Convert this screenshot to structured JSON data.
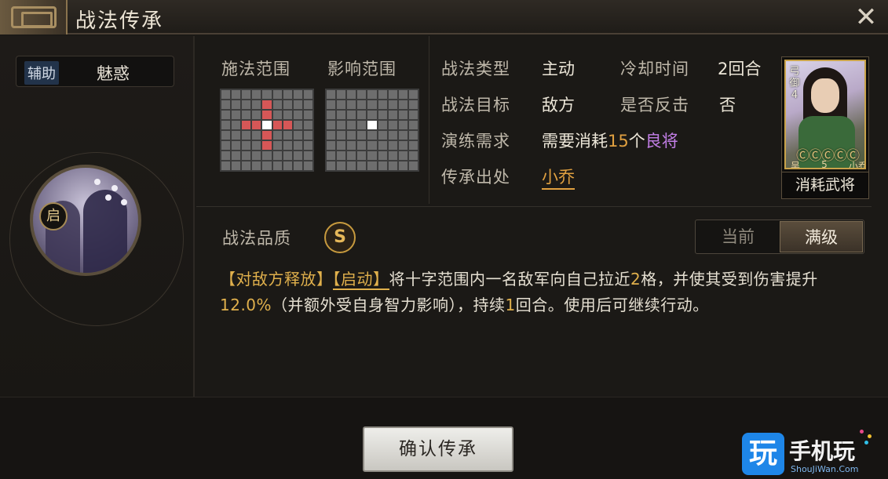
{
  "window": {
    "title": "战法传承"
  },
  "skill": {
    "category_badge": "辅助",
    "name": "魅惑",
    "badge": "启"
  },
  "range": {
    "cast_label": "施法范围",
    "effect_label": "影响范围",
    "cast_grid": {
      "rows": 8,
      "cols": 9,
      "cells": [
        "---------",
        "----r----",
        "----r----",
        "--rrwrr--",
        "----r----",
        "----r----",
        "---------",
        "---------"
      ]
    },
    "effect_grid": {
      "rows": 8,
      "cols": 9,
      "cells": [
        "---------",
        "---------",
        "---------",
        "----w----",
        "---------",
        "---------",
        "---------",
        "---------"
      ]
    }
  },
  "info": {
    "type_label": "战法类型",
    "type_value": "主动",
    "cooldown_label": "冷却时间",
    "cooldown_value": "2回合",
    "target_label": "战法目标",
    "target_value": "敌方",
    "counter_label": "是否反击",
    "counter_value": "否",
    "practice_label": "演练需求",
    "practice_prefix": "需要消耗",
    "practice_count": "15",
    "practice_unit": "个",
    "practice_rank": "良将",
    "source_label": "传承出处",
    "source_value": "小乔"
  },
  "hero_card": {
    "side_text": "弓御4",
    "stars": "ⒸⒸⒸⒸⒸ",
    "faction": "吴",
    "cost": "5",
    "name": "小乔",
    "footer": "消耗武将"
  },
  "quality": {
    "label": "战法品质",
    "grade": "S"
  },
  "level_toggle": {
    "current": "当前",
    "max": "满级",
    "selected": "max"
  },
  "description": {
    "tag1": "【对敌方释放】",
    "tag2": "【启动】",
    "text1": "将十字范围内一名敌军向自己拉近",
    "n1": "2",
    "text2": "格，并使其受到伤害提升",
    "n2": "12.0%",
    "text3": "（并额外受自身智力影响），持续",
    "n3": "1",
    "text4": "回合。使用后可继续行动。"
  },
  "buttons": {
    "confirm": "确认传承",
    "close": "✕"
  },
  "watermark": {
    "icon": "玩",
    "text": "手机玩",
    "url": "ShouJiWan.Com"
  },
  "colors": {
    "accent_gold": "#e0b04c",
    "rank_purple": "#c27ee6",
    "range_red": "#d65757",
    "watermark_blue": "#1e86e8"
  }
}
